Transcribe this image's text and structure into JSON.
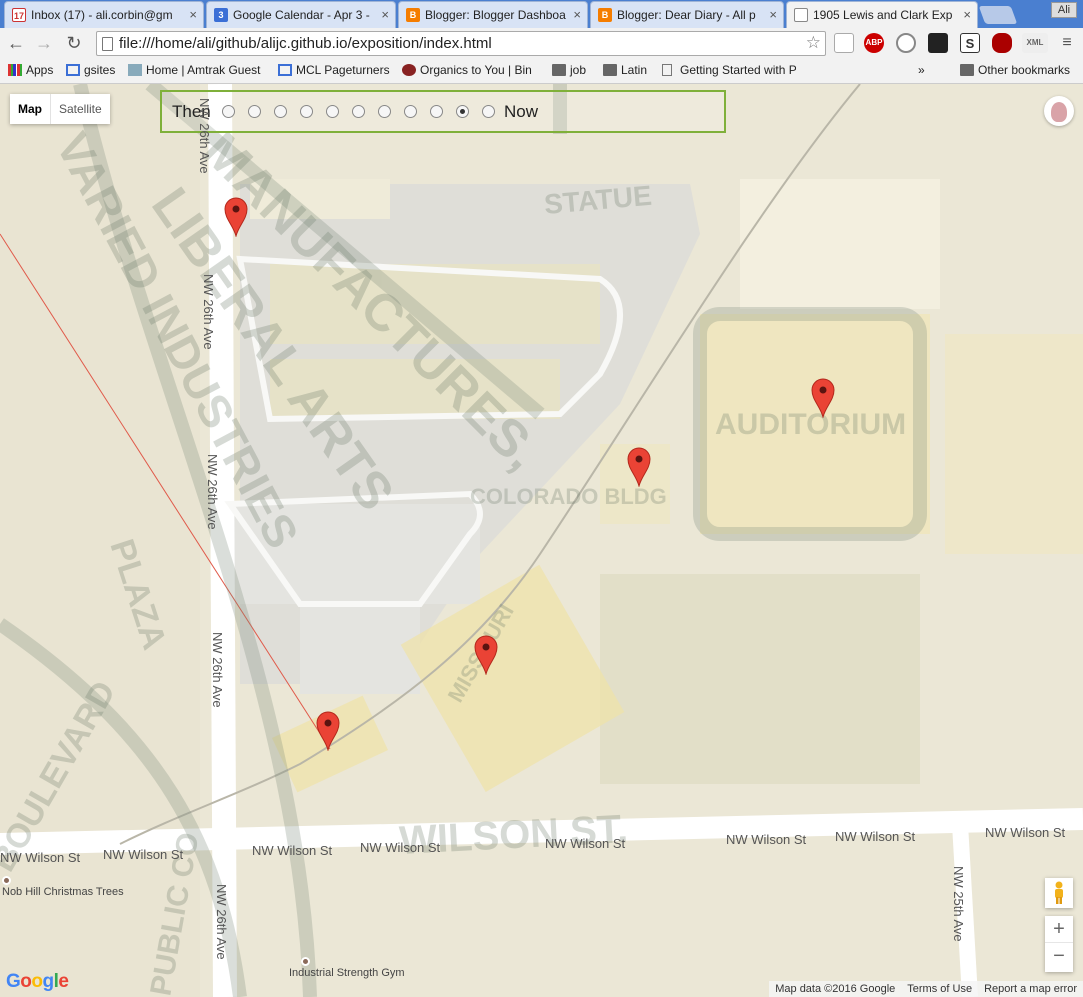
{
  "tabs": [
    {
      "title": "Inbox (17) - ali.corbin@gm",
      "favicon": "gmail-icon",
      "badge": "17",
      "active": false
    },
    {
      "title": "Google Calendar - Apr 3 -",
      "favicon": "calendar-icon",
      "badge": "3",
      "active": false
    },
    {
      "title": "Blogger: Blogger Dashboa",
      "favicon": "blogger-icon",
      "active": false
    },
    {
      "title": "Blogger: Dear Diary - All p",
      "favicon": "blogger-icon",
      "active": false
    },
    {
      "title": "1905 Lewis and Clark Exp",
      "favicon": "page-icon",
      "active": true
    }
  ],
  "profile_name": "Ali",
  "address_bar": {
    "url": "file:///home/ali/github/alijc.github.io/exposition/index.html"
  },
  "extensions": [
    "calendar-icon",
    "adblock-icon",
    "search-icon",
    "ghost-icon",
    "s-icon",
    "car-icon",
    "xml-icon"
  ],
  "extension_labels": {
    "adblock": "ABP",
    "s": "S",
    "xml": "XML"
  },
  "bookmarks": [
    {
      "label": "Apps",
      "icon": "apps-grid-icon"
    },
    {
      "label": "gsites",
      "icon": "sites-icon"
    },
    {
      "label": "Home | Amtrak Guest",
      "icon": "amtrak-icon"
    },
    {
      "label": "MCL Pageturners",
      "icon": "sites-icon"
    },
    {
      "label": "Organics to You | Bin",
      "icon": "organics-icon"
    },
    {
      "label": "job",
      "icon": "folder-icon"
    },
    {
      "label": "Latin",
      "icon": "folder-icon"
    },
    {
      "label": "Getting Started with P",
      "icon": "page-icon"
    }
  ],
  "bookmarks_overflow": "»",
  "other_bookmarks": "Other bookmarks",
  "map": {
    "type_buttons": {
      "map": "Map",
      "satellite": "Satellite"
    },
    "slider": {
      "then": "Then",
      "now": "Now",
      "steps": 11,
      "selected_index": 9
    },
    "roads": {
      "nw26th": "NW 26th Ave",
      "nw25th": "NW 25th Ave",
      "wilson": "NW Wilson St"
    },
    "pois": [
      {
        "name": "Nob Hill Christmas Trees"
      },
      {
        "name": "Industrial Strength Gym"
      }
    ],
    "zoom": {
      "in": "+",
      "out": "−"
    },
    "footer": {
      "data": "Map data ©2016 Google",
      "terms": "Terms of Use",
      "report": "Report a map error"
    },
    "logo": "Google",
    "overlay_text": [
      "MANUFACTURES,",
      "LIBERAL ARTS",
      "VARIED INDUSTRIES",
      "PLAZA",
      "STATUE",
      "AUDITORIUM",
      "COLORADO BLDG",
      "MISSOURI",
      "WILSON ST.",
      "BOULEVARD",
      "PUBLIC CO"
    ]
  }
}
